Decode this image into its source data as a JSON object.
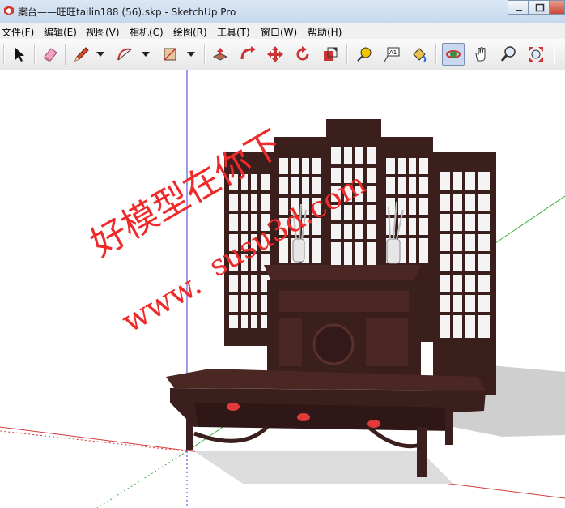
{
  "window": {
    "title": "案台——旺旺tailin188 (56).skp - SketchUp Pro"
  },
  "menu": [
    "文件(F)",
    "编辑(E)",
    "视图(V)",
    "相机(C)",
    "绘图(R)",
    "工具(T)",
    "窗口(W)",
    "帮助(H)"
  ],
  "toolbar": {
    "tools": [
      "select",
      "eraser",
      "pencil",
      "arc",
      "rectangle",
      "push-pull",
      "follow-me",
      "move",
      "rotate",
      "scale",
      "tape-measure",
      "text",
      "paint-bucket",
      "orbit",
      "pan",
      "zoom",
      "zoom-extents"
    ],
    "active_tool": "orbit",
    "text_tool_label": "A1"
  },
  "watermark": {
    "line1": "好模型在你下",
    "line2": "susu3d.com",
    "line3": "www."
  },
  "colors": {
    "axis_red": "#d43a3a",
    "axis_green": "#3fae3f",
    "axis_blue": "#3a3ad4",
    "wood": "#3a1f1c",
    "watermark": "#ee2a2a"
  }
}
